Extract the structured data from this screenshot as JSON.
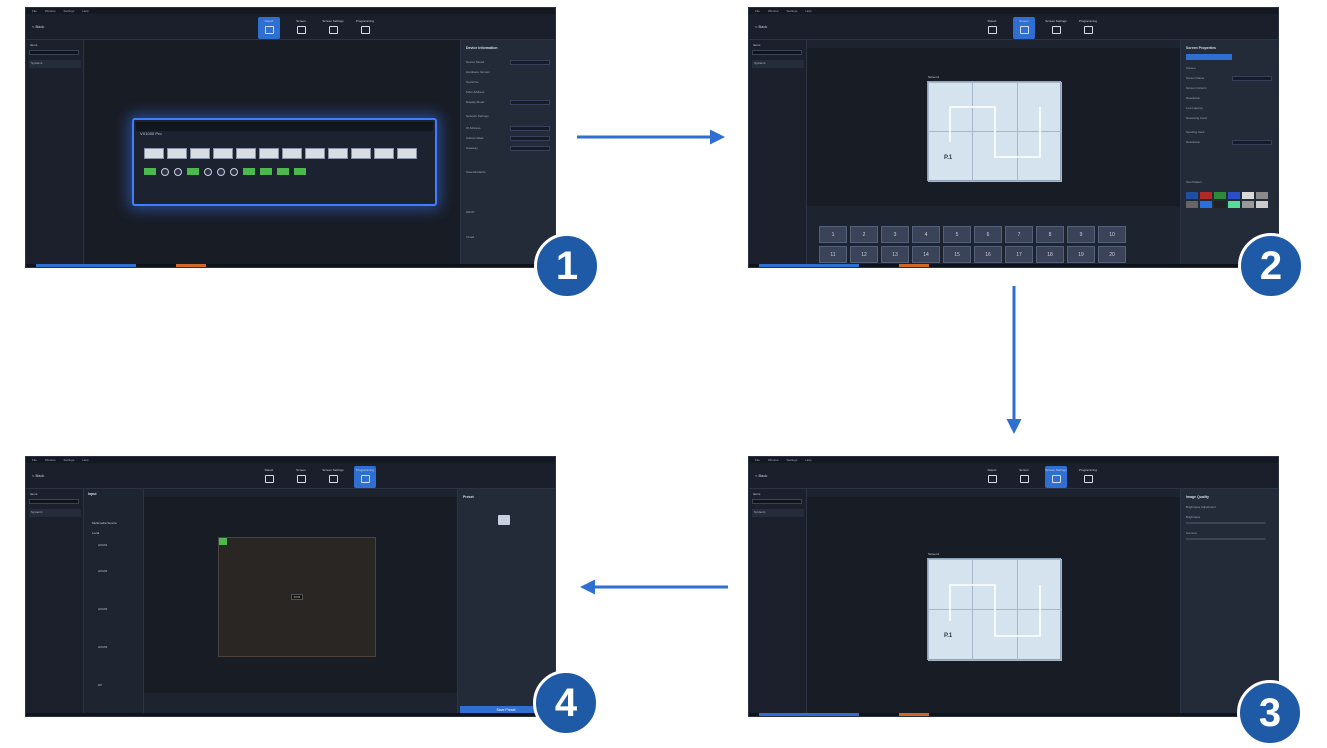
{
  "panels": [
    {
      "id": 1,
      "menu": [
        "File",
        "Window",
        "Settings",
        "Help"
      ],
      "back": "< Back",
      "left_label": "Items",
      "left_item": "System1",
      "modes": [
        {
          "label": "Detect",
          "active": true
        },
        {
          "label": "Screen",
          "active": false
        },
        {
          "label": "Screen Settings",
          "active": false
        },
        {
          "label": "Programming",
          "active": false
        }
      ],
      "right_title": "Device Information",
      "right_rows": [
        "Device Model",
        "Hardware Version",
        "Serial No.",
        "MAC Address",
        "Display Mode",
        "Network Settings",
        "IP Address",
        "Subnet Mask",
        "Gateway",
        "Save&Initialize",
        "HDCP",
        "Timed"
      ],
      "device_label": "VX1000 Pro",
      "badge": "1"
    },
    {
      "id": 2,
      "menu": [
        "File",
        "Window",
        "Settings",
        "Help"
      ],
      "back": "< Back",
      "left_label": "Items",
      "left_item": "System1",
      "modes": [
        {
          "label": "Detect",
          "active": false
        },
        {
          "label": "Screen",
          "active": true
        },
        {
          "label": "Screen Settings",
          "active": false
        },
        {
          "label": "Programming",
          "active": false
        }
      ],
      "right_title": "Screen Properties",
      "right_rows": [
        "Screen",
        "Screen Name",
        "Screen Column",
        "Resolution",
        "Low Latency",
        "Receiving Card",
        "Sending Card",
        "Resolution",
        "Test Pattern"
      ],
      "wall_label": "Screen1",
      "wall_text": "P.1",
      "preset_buttons": [
        "1",
        "2",
        "3",
        "4",
        "5",
        "6",
        "7",
        "8",
        "9",
        "10",
        "11",
        "12",
        "13",
        "14",
        "15",
        "16",
        "17",
        "18",
        "19",
        "20"
      ],
      "badge": "2"
    },
    {
      "id": 3,
      "menu": [
        "File",
        "Window",
        "Settings",
        "Help"
      ],
      "back": "< Back",
      "left_label": "Items",
      "left_item": "System1",
      "modes": [
        {
          "label": "Detect",
          "active": false
        },
        {
          "label": "Screen",
          "active": false
        },
        {
          "label": "Screen Settings",
          "active": true
        },
        {
          "label": "Programming",
          "active": false
        }
      ],
      "right_title": "Image Quality",
      "right_rows": [
        "Brightness Adjustment",
        "Brightness",
        "Gamma"
      ],
      "wall_label": "Screen1",
      "wall_text": "P.1",
      "badge": "3"
    },
    {
      "id": 4,
      "menu": [
        "File",
        "Window",
        "Settings",
        "Help"
      ],
      "back": "< Back",
      "left_label": "Items",
      "left_item": "System1",
      "modes": [
        {
          "label": "Detect",
          "active": false
        },
        {
          "label": "Screen",
          "active": false
        },
        {
          "label": "Screen Settings",
          "active": false
        },
        {
          "label": "Programming",
          "active": true
        }
      ],
      "right_title": "Preset",
      "right_rows": [],
      "input_title": "Input",
      "input_items": [
        "Multimedia Source",
        "Local",
        "HDMI1",
        "HDMI2",
        "HDMI3",
        "HDMI4",
        "DP"
      ],
      "layer_tag": "DVI1",
      "save_button": "Save Preset",
      "badge": "4"
    }
  ],
  "colors": {
    "arrow": "#2f6fd1",
    "badge": "#1f5aa6",
    "active_mode": "#2f6fd1"
  }
}
